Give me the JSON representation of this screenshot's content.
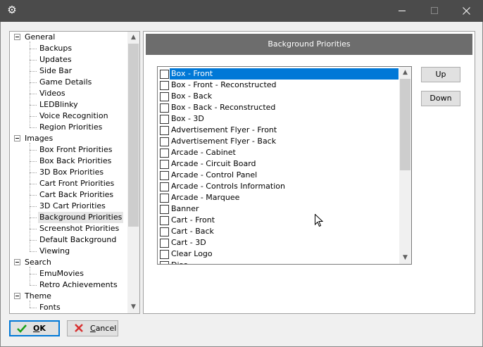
{
  "window": {
    "app_icon": "gear-icon",
    "controls": [
      "minimize-icon",
      "maximize-icon",
      "close-icon"
    ]
  },
  "tree": {
    "items": [
      {
        "label": "General",
        "level": 0
      },
      {
        "label": "Backups",
        "level": 1
      },
      {
        "label": "Updates",
        "level": 1
      },
      {
        "label": "Side Bar",
        "level": 1
      },
      {
        "label": "Game Details",
        "level": 1
      },
      {
        "label": "Videos",
        "level": 1
      },
      {
        "label": "LEDBlinky",
        "level": 1
      },
      {
        "label": "Voice Recognition",
        "level": 1
      },
      {
        "label": "Region Priorities",
        "level": 1
      },
      {
        "label": "Images",
        "level": 0
      },
      {
        "label": "Box Front Priorities",
        "level": 1
      },
      {
        "label": "Box Back Priorities",
        "level": 1
      },
      {
        "label": "3D Box Priorities",
        "level": 1
      },
      {
        "label": "Cart Front Priorities",
        "level": 1
      },
      {
        "label": "Cart Back Priorities",
        "level": 1
      },
      {
        "label": "3D Cart Priorities",
        "level": 1
      },
      {
        "label": "Background Priorities",
        "level": 1,
        "selected": true
      },
      {
        "label": "Screenshot Priorities",
        "level": 1
      },
      {
        "label": "Default Background",
        "level": 1
      },
      {
        "label": "Viewing",
        "level": 1
      },
      {
        "label": "Search",
        "level": 0
      },
      {
        "label": "EmuMovies",
        "level": 1
      },
      {
        "label": "Retro Achievements",
        "level": 1
      },
      {
        "label": "Theme",
        "level": 0
      },
      {
        "label": "Fonts",
        "level": 1
      }
    ]
  },
  "panel": {
    "title": "Background Priorities",
    "items": [
      {
        "label": "Box - Front",
        "selected": true
      },
      {
        "label": "Box - Front - Reconstructed"
      },
      {
        "label": "Box - Back"
      },
      {
        "label": "Box - Back - Reconstructed"
      },
      {
        "label": "Box - 3D"
      },
      {
        "label": "Advertisement Flyer - Front"
      },
      {
        "label": "Advertisement Flyer - Back"
      },
      {
        "label": "Arcade - Cabinet"
      },
      {
        "label": "Arcade - Circuit Board"
      },
      {
        "label": "Arcade - Control Panel"
      },
      {
        "label": "Arcade - Controls Information"
      },
      {
        "label": "Arcade - Marquee"
      },
      {
        "label": "Banner"
      },
      {
        "label": "Cart - Front"
      },
      {
        "label": "Cart - Back"
      },
      {
        "label": "Cart - 3D"
      },
      {
        "label": "Clear Logo"
      },
      {
        "label": "Disc"
      }
    ],
    "up_label": "Up",
    "down_label": "Down"
  },
  "footer": {
    "ok_label": "OK",
    "cancel_label": "Cancel",
    "ok_icon": "checkmark-icon",
    "cancel_icon": "red-x-icon"
  },
  "colors": {
    "titlebar": "#4b4b4b",
    "selection": "#0078d7",
    "header": "#6d6d6d",
    "ok_check": "#1aa01a",
    "cancel_x": "#d83030"
  }
}
